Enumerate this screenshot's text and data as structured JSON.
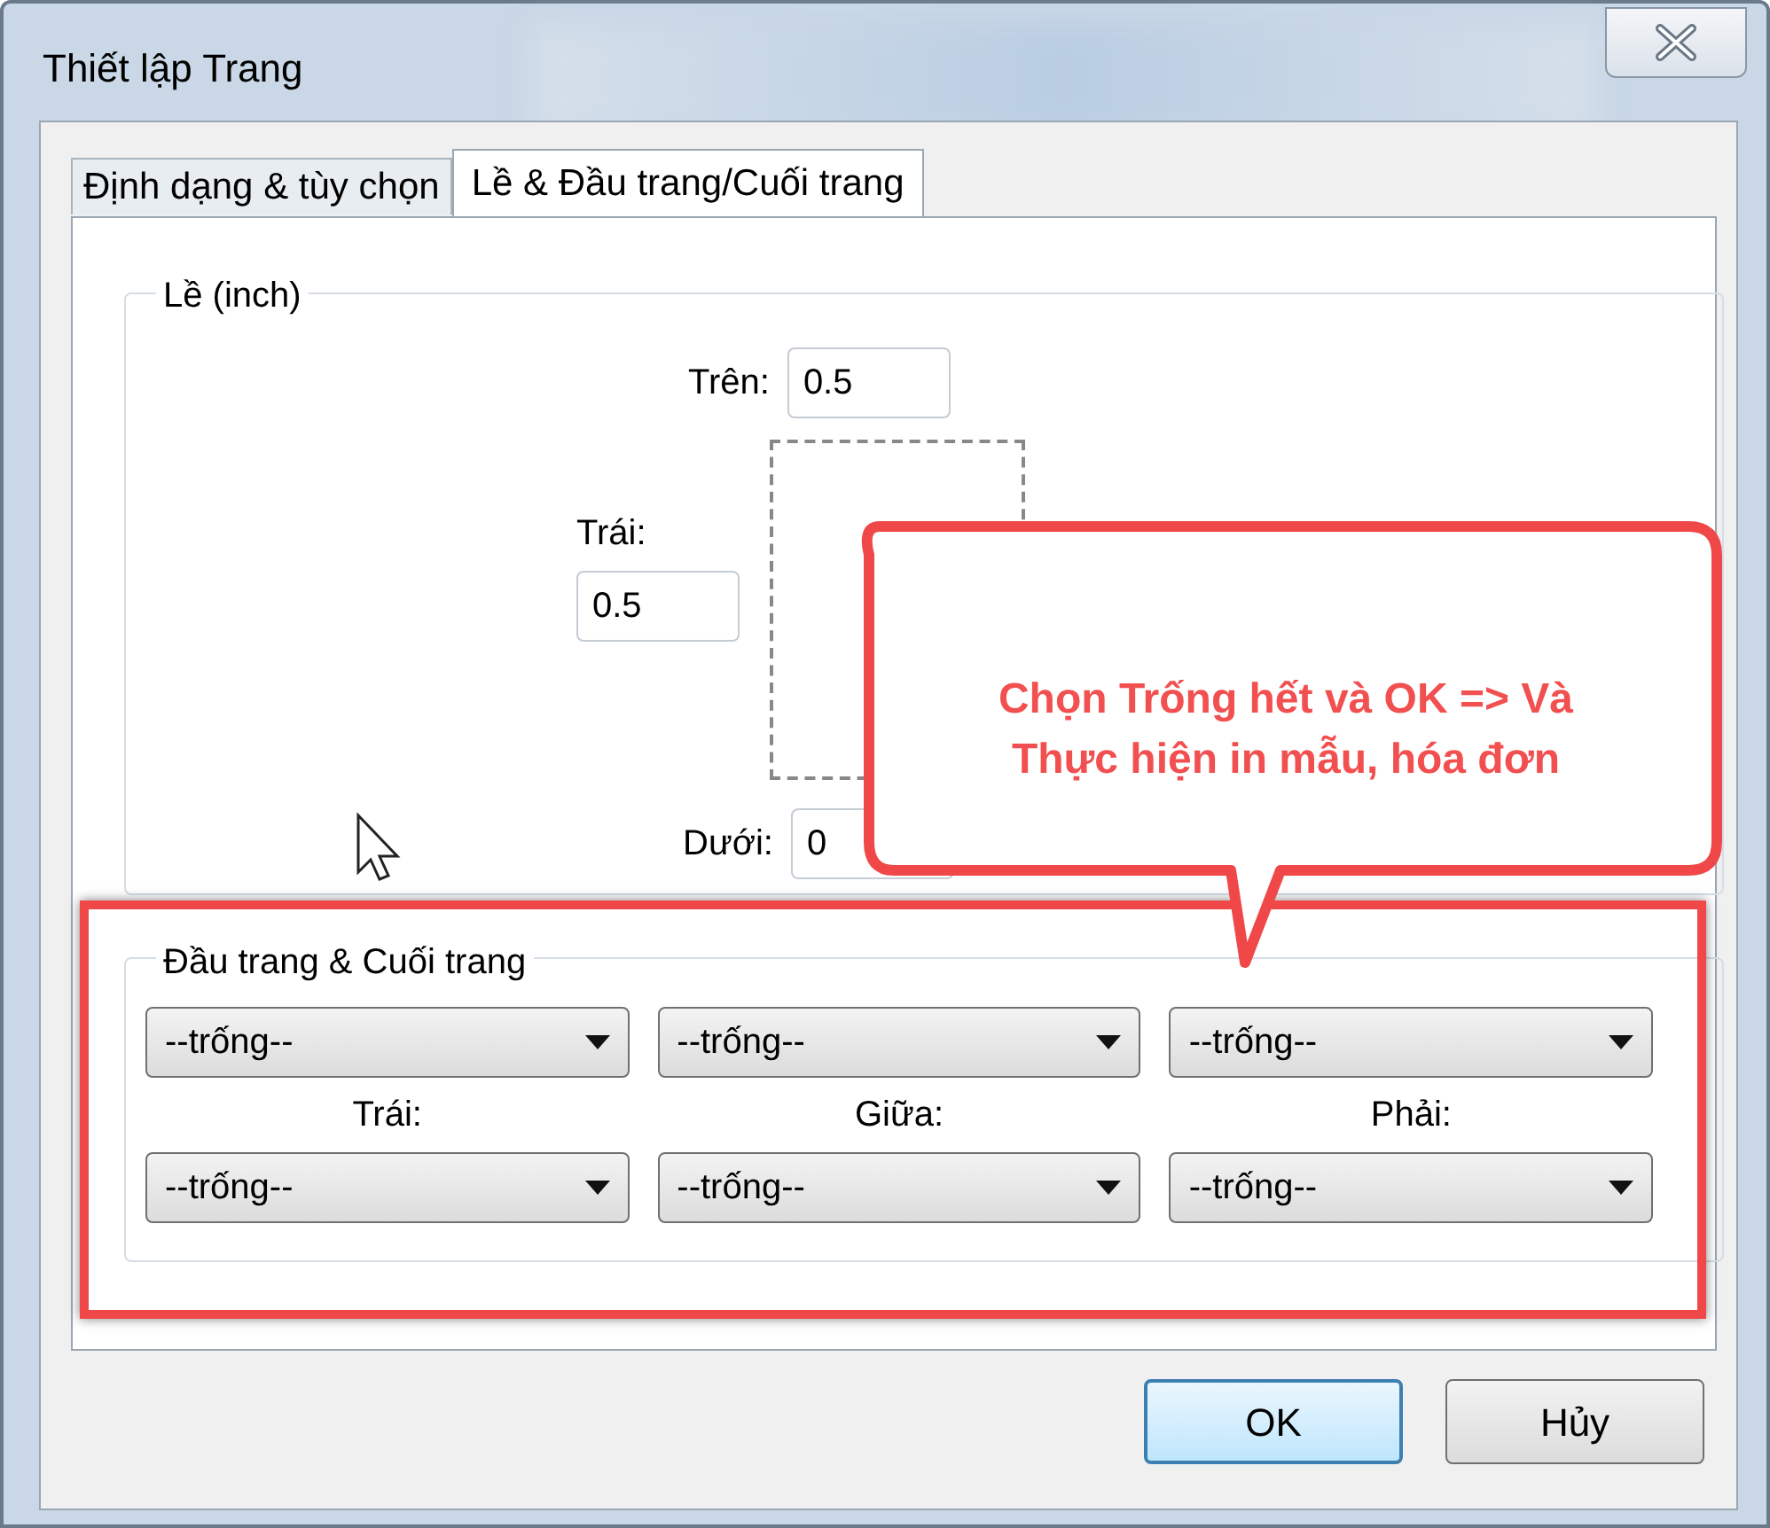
{
  "window": {
    "title": "Thiết lập Trang"
  },
  "tabs": [
    {
      "label": "Định dạng & tùy chọn",
      "selected": false
    },
    {
      "label": "Lề & Đầu trang/Cuối trang",
      "selected": true
    }
  ],
  "margins": {
    "title": "Lề (inch)",
    "fields": [
      {
        "kind": "top",
        "label": "Trên:",
        "value": "0.5"
      },
      {
        "kind": "left",
        "label": "Trái:",
        "value": "0.5"
      },
      {
        "kind": "bottom",
        "label": "Dưới:",
        "value": "0"
      }
    ]
  },
  "header_footer": {
    "title": "Đầu trang & Cuối trang",
    "headers": [
      {
        "value": "--trống--"
      },
      {
        "value": "--trống--"
      },
      {
        "value": "--trống--"
      }
    ],
    "labels": [
      "Trái:",
      "Giữa:",
      "Phải:"
    ],
    "footers": [
      {
        "value": "--trống--"
      },
      {
        "value": "--trống--"
      },
      {
        "value": "--trống--"
      }
    ]
  },
  "buttons": [
    {
      "label": "OK",
      "default": true
    },
    {
      "label": "Hủy",
      "default": false
    }
  ],
  "callout": {
    "lines": [
      "Chọn Trống hết và OK => Và",
      "Thực hiện in mẫu, hóa đơn"
    ]
  }
}
